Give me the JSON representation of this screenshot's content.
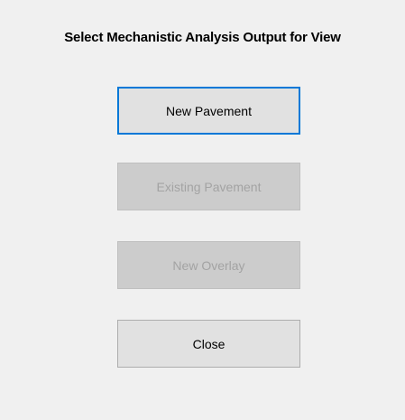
{
  "dialog": {
    "title": "Select Mechanistic Analysis Output for View"
  },
  "buttons": {
    "new_pavement": "New Pavement",
    "existing_pavement": "Existing Pavement",
    "new_overlay": "New Overlay",
    "close": "Close"
  },
  "colors": {
    "window_background": "#f0f0f0",
    "button_background": "#e1e1e1",
    "disabled_button_background": "#cccccc",
    "disabled_text": "#a3a3a3",
    "focus_border": "#0078d7"
  }
}
